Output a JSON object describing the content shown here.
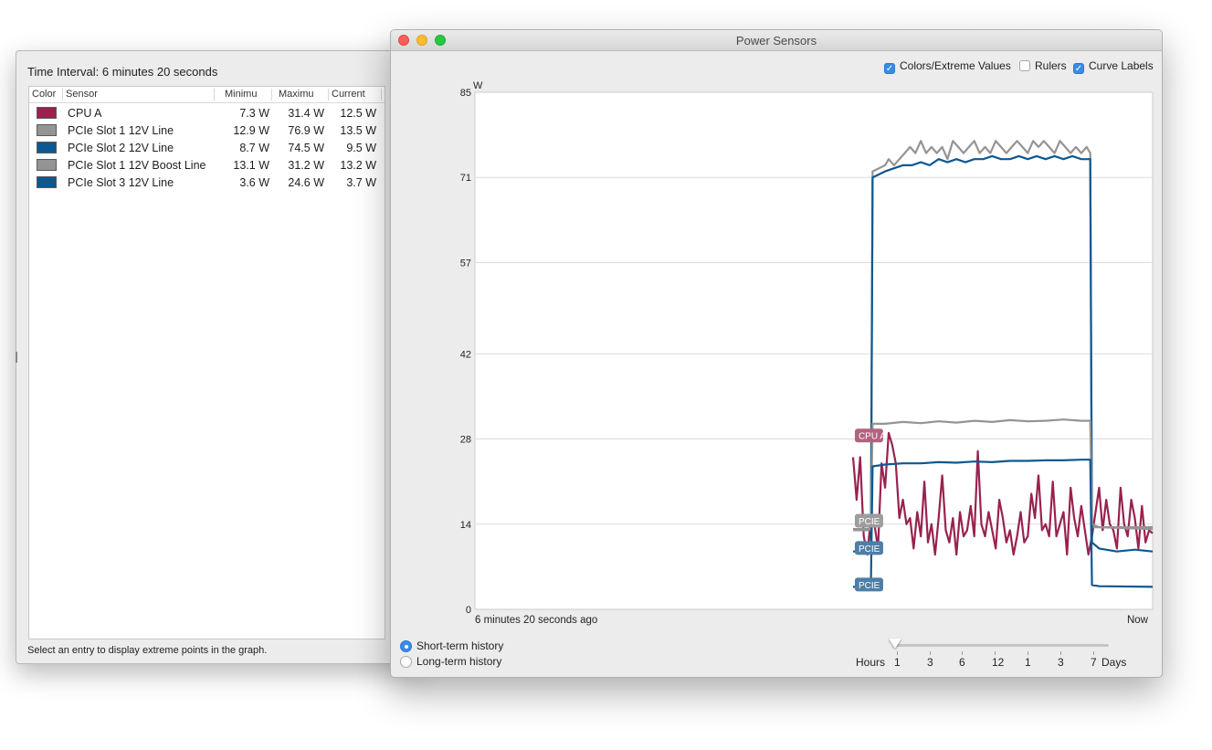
{
  "sensor_list": {
    "interval_label": "Time Interval: 6 minutes 20 seconds",
    "columns": [
      "Color",
      "Sensor",
      "Minimu",
      "Maximu",
      "Current"
    ],
    "rows": [
      {
        "color": "#98224f",
        "sensor": "CPU A",
        "min": "7.3 W",
        "max": "31.4 W",
        "current": "12.5 W"
      },
      {
        "color": "#949494",
        "sensor": "PCIe Slot 1 12V Line",
        "min": "12.9 W",
        "max": "76.9 W",
        "current": "13.5 W"
      },
      {
        "color": "#0d5891",
        "sensor": "PCIe Slot 2 12V Line",
        "min": "8.7 W",
        "max": "74.5 W",
        "current": "9.5 W"
      },
      {
        "color": "#949494",
        "sensor": "PCIe Slot 1 12V Boost Line",
        "min": "13.1 W",
        "max": "31.2 W",
        "current": "13.2 W"
      },
      {
        "color": "#0d5891",
        "sensor": "PCIe Slot 3 12V Line",
        "min": "3.6 W",
        "max": "24.6 W",
        "current": "3.7 W"
      }
    ],
    "status": "Select an entry to display extreme points in the graph."
  },
  "window": {
    "title": "Power Sensors",
    "options": {
      "colors_extreme": {
        "label": "Colors/Extreme Values",
        "checked": true
      },
      "rulers": {
        "label": "Rulers",
        "checked": false
      },
      "curve_labels": {
        "label": "Curve Labels",
        "checked": true
      }
    },
    "history": {
      "short_term": {
        "label": "Short-term history",
        "selected": true
      },
      "long_term": {
        "label": "Long-term history",
        "selected": false
      }
    },
    "slider": {
      "hours_label": "Hours",
      "days_label": "Days",
      "tick_labels": [
        "1",
        "3",
        "6",
        "12",
        "1",
        "3",
        "7"
      ],
      "selected": "1"
    }
  },
  "chart_data": {
    "type": "line",
    "unit": "W",
    "y_ticks": [
      "85",
      "71",
      "57",
      "42",
      "28",
      "14",
      "0"
    ],
    "ylim": [
      0,
      85
    ],
    "xlim": [
      -380,
      0
    ],
    "x_start_label": "6 minutes 20 seconds ago",
    "x_end_label": "Now",
    "grid": true,
    "curve_labels": [
      "CPU A",
      "PCIE",
      "PCIE",
      "PCIE"
    ],
    "series": [
      {
        "name": "CPU A",
        "color": "#98224f",
        "points": [
          [
            -168,
            25
          ],
          [
            -166,
            18
          ],
          [
            -164,
            25
          ],
          [
            -162,
            12
          ],
          [
            -160,
            9
          ],
          [
            -158,
            15
          ],
          [
            -156,
            14
          ],
          [
            -154,
            10
          ],
          [
            -152,
            24
          ],
          [
            -150,
            20
          ],
          [
            -148,
            29
          ],
          [
            -146,
            27
          ],
          [
            -144,
            24
          ],
          [
            -142,
            15
          ],
          [
            -140,
            18
          ],
          [
            -138,
            14
          ],
          [
            -136,
            15
          ],
          [
            -134,
            10
          ],
          [
            -132,
            16
          ],
          [
            -130,
            12
          ],
          [
            -128,
            21
          ],
          [
            -126,
            11
          ],
          [
            -124,
            14
          ],
          [
            -122,
            9
          ],
          [
            -120,
            15
          ],
          [
            -118,
            22
          ],
          [
            -116,
            13
          ],
          [
            -114,
            11
          ],
          [
            -112,
            15
          ],
          [
            -110,
            9
          ],
          [
            -108,
            16
          ],
          [
            -106,
            12
          ],
          [
            -104,
            13
          ],
          [
            -102,
            17
          ],
          [
            -100,
            12
          ],
          [
            -98,
            26
          ],
          [
            -96,
            14
          ],
          [
            -94,
            12
          ],
          [
            -92,
            16
          ],
          [
            -90,
            13
          ],
          [
            -88,
            10
          ],
          [
            -86,
            18
          ],
          [
            -84,
            15
          ],
          [
            -82,
            11
          ],
          [
            -80,
            13
          ],
          [
            -78,
            9
          ],
          [
            -76,
            12
          ],
          [
            -74,
            16
          ],
          [
            -72,
            11
          ],
          [
            -70,
            12
          ],
          [
            -68,
            19
          ],
          [
            -66,
            15
          ],
          [
            -64,
            22
          ],
          [
            -62,
            13
          ],
          [
            -60,
            14
          ],
          [
            -58,
            12
          ],
          [
            -56,
            21
          ],
          [
            -54,
            12
          ],
          [
            -52,
            14
          ],
          [
            -50,
            16
          ],
          [
            -48,
            9
          ],
          [
            -46,
            20
          ],
          [
            -44,
            15
          ],
          [
            -42,
            12
          ],
          [
            -40,
            17
          ],
          [
            -38,
            13
          ],
          [
            -36,
            9
          ],
          [
            -34,
            12
          ],
          [
            -32,
            16
          ],
          [
            -30,
            20
          ],
          [
            -28,
            13
          ],
          [
            -26,
            18
          ],
          [
            -24,
            14
          ],
          [
            -22,
            13
          ],
          [
            -20,
            10
          ],
          [
            -18,
            20
          ],
          [
            -16,
            14
          ],
          [
            -14,
            12
          ],
          [
            -12,
            18
          ],
          [
            -10,
            15
          ],
          [
            -8,
            10
          ],
          [
            -6,
            17
          ],
          [
            -4,
            11
          ],
          [
            -2,
            13
          ],
          [
            0,
            12.5
          ]
        ]
      },
      {
        "name": "PCIe Slot 1 12V Line",
        "color": "#949494",
        "points": [
          [
            -168,
            13
          ],
          [
            -158,
            13
          ],
          [
            -157,
            72
          ],
          [
            -150,
            73
          ],
          [
            -148,
            74
          ],
          [
            -145,
            73
          ],
          [
            -142,
            74
          ],
          [
            -139,
            75
          ],
          [
            -136,
            76
          ],
          [
            -133,
            75
          ],
          [
            -130,
            77
          ],
          [
            -127,
            75
          ],
          [
            -124,
            76
          ],
          [
            -121,
            75
          ],
          [
            -118,
            76
          ],
          [
            -115,
            74
          ],
          [
            -112,
            77
          ],
          [
            -109,
            76
          ],
          [
            -106,
            75
          ],
          [
            -103,
            76
          ],
          [
            -100,
            77
          ],
          [
            -97,
            75
          ],
          [
            -94,
            76
          ],
          [
            -91,
            75
          ],
          [
            -88,
            77
          ],
          [
            -85,
            76
          ],
          [
            -82,
            75
          ],
          [
            -79,
            76
          ],
          [
            -76,
            77
          ],
          [
            -73,
            76
          ],
          [
            -70,
            75
          ],
          [
            -67,
            77
          ],
          [
            -64,
            76
          ],
          [
            -61,
            77
          ],
          [
            -58,
            76
          ],
          [
            -55,
            75
          ],
          [
            -52,
            77
          ],
          [
            -49,
            76
          ],
          [
            -46,
            75
          ],
          [
            -43,
            76
          ],
          [
            -40,
            75
          ],
          [
            -37,
            76
          ],
          [
            -35,
            75
          ],
          [
            -34,
            13.5
          ],
          [
            -30,
            13.5
          ],
          [
            0,
            13.5
          ]
        ]
      },
      {
        "name": "PCIe Slot 2 12V Line",
        "color": "#0d5891",
        "points": [
          [
            -168,
            9.5
          ],
          [
            -158,
            9.5
          ],
          [
            -157,
            71
          ],
          [
            -150,
            72
          ],
          [
            -145,
            72.5
          ],
          [
            -140,
            73
          ],
          [
            -135,
            73
          ],
          [
            -130,
            73.5
          ],
          [
            -125,
            73
          ],
          [
            -120,
            74
          ],
          [
            -115,
            73.5
          ],
          [
            -110,
            74
          ],
          [
            -105,
            73.5
          ],
          [
            -100,
            74
          ],
          [
            -95,
            74
          ],
          [
            -90,
            74.5
          ],
          [
            -85,
            74
          ],
          [
            -80,
            74
          ],
          [
            -75,
            74.5
          ],
          [
            -70,
            74
          ],
          [
            -65,
            74.5
          ],
          [
            -60,
            74
          ],
          [
            -55,
            74.5
          ],
          [
            -50,
            74
          ],
          [
            -45,
            74.5
          ],
          [
            -40,
            74
          ],
          [
            -35,
            74
          ],
          [
            -34,
            11
          ],
          [
            -30,
            10
          ],
          [
            -20,
            9.5
          ],
          [
            -10,
            9.8
          ],
          [
            0,
            9.5
          ]
        ]
      },
      {
        "name": "PCIe Slot 1 12V Boost Line",
        "color": "#949494",
        "points": [
          [
            -168,
            13.2
          ],
          [
            -158,
            13.2
          ],
          [
            -157,
            30.5
          ],
          [
            -150,
            30.5
          ],
          [
            -140,
            30.8
          ],
          [
            -130,
            30.6
          ],
          [
            -120,
            30.9
          ],
          [
            -110,
            30.7
          ],
          [
            -100,
            31
          ],
          [
            -90,
            30.8
          ],
          [
            -80,
            31.1
          ],
          [
            -70,
            30.9
          ],
          [
            -60,
            31
          ],
          [
            -50,
            31.2
          ],
          [
            -40,
            31
          ],
          [
            -35,
            31
          ],
          [
            -34,
            14
          ],
          [
            -30,
            13.5
          ],
          [
            0,
            13.2
          ]
        ]
      },
      {
        "name": "PCIe Slot 3 12V Line",
        "color": "#0d5891",
        "points": [
          [
            -168,
            3.7
          ],
          [
            -158,
            3.7
          ],
          [
            -157,
            23.5
          ],
          [
            -150,
            23.8
          ],
          [
            -140,
            24
          ],
          [
            -130,
            24
          ],
          [
            -120,
            24.2
          ],
          [
            -110,
            24.1
          ],
          [
            -100,
            24.3
          ],
          [
            -90,
            24.2
          ],
          [
            -80,
            24.4
          ],
          [
            -70,
            24.4
          ],
          [
            -60,
            24.5
          ],
          [
            -50,
            24.5
          ],
          [
            -40,
            24.6
          ],
          [
            -35,
            24.6
          ],
          [
            -34,
            4
          ],
          [
            -30,
            3.8
          ],
          [
            0,
            3.7
          ]
        ]
      }
    ]
  }
}
